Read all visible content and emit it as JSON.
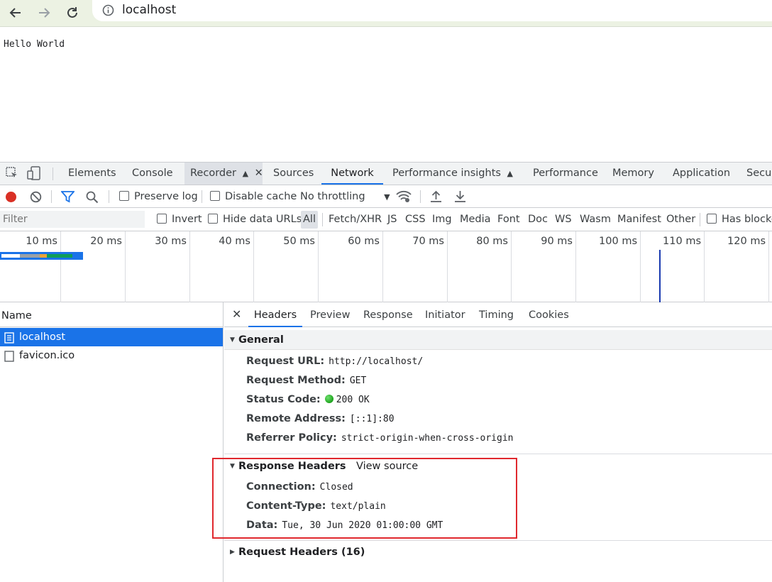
{
  "browser": {
    "url": "localhost",
    "nav": {
      "back": "back-arrow-icon",
      "forward": "forward-arrow-icon",
      "reload": "reload-icon",
      "info": "info-icon"
    }
  },
  "page": {
    "body_text": "Hello World"
  },
  "devtools": {
    "tabs": [
      {
        "label": "Elements"
      },
      {
        "label": "Console"
      },
      {
        "label": "Recorder"
      },
      {
        "label": "Sources"
      },
      {
        "label": "Network"
      },
      {
        "label": "Performance insights"
      },
      {
        "label": "Performance"
      },
      {
        "label": "Memory"
      },
      {
        "label": "Application"
      },
      {
        "label": "Secur"
      }
    ],
    "active_tab": "Network",
    "toolbar": {
      "preserve_log": "Preserve log",
      "disable_cache": "Disable cache",
      "throttling": "No throttling"
    },
    "filter": {
      "placeholder": "Filter",
      "invert": "Invert",
      "hide_data_urls": "Hide data URLs",
      "types": [
        "All",
        "Fetch/XHR",
        "JS",
        "CSS",
        "Img",
        "Media",
        "Font",
        "Doc",
        "WS",
        "Wasm",
        "Manifest",
        "Other"
      ],
      "has_blocked": "Has blocke"
    },
    "timeline": {
      "ticks": [
        "10 ms",
        "20 ms",
        "30 ms",
        "40 ms",
        "50 ms",
        "60 ms",
        "70 ms",
        "80 ms",
        "90 ms",
        "100 ms",
        "110 ms",
        "120 ms"
      ]
    },
    "requests": {
      "column_name": "Name",
      "items": [
        {
          "name": "localhost",
          "selected": true
        },
        {
          "name": "favicon.ico",
          "selected": false
        }
      ]
    },
    "details": {
      "tabs": [
        "Headers",
        "Preview",
        "Response",
        "Initiator",
        "Timing",
        "Cookies"
      ],
      "active": "Headers",
      "general": {
        "title": "General",
        "rows": [
          {
            "key": "Request URL:",
            "value": "http://localhost/"
          },
          {
            "key": "Request Method:",
            "value": "GET"
          },
          {
            "key": "Status Code:",
            "value": "200 OK"
          },
          {
            "key": "Remote Address:",
            "value": "[::1]:80"
          },
          {
            "key": "Referrer Policy:",
            "value": "strict-origin-when-cross-origin"
          }
        ]
      },
      "response_headers": {
        "title": "Response Headers",
        "view_source": "View source",
        "rows": [
          {
            "key": "Connection:",
            "value": "Closed"
          },
          {
            "key": "Content-Type:",
            "value": "text/plain"
          },
          {
            "key": "Data:",
            "value": "Tue, 30 Jun 2020 01:00:00 GMT"
          }
        ]
      },
      "request_headers": {
        "title": "Request Headers (16)"
      }
    }
  },
  "colors": {
    "accent": "#1a73e8",
    "highlight_box": "#e0282e",
    "status_ok": "#1ea31e",
    "record": "#d93025"
  }
}
